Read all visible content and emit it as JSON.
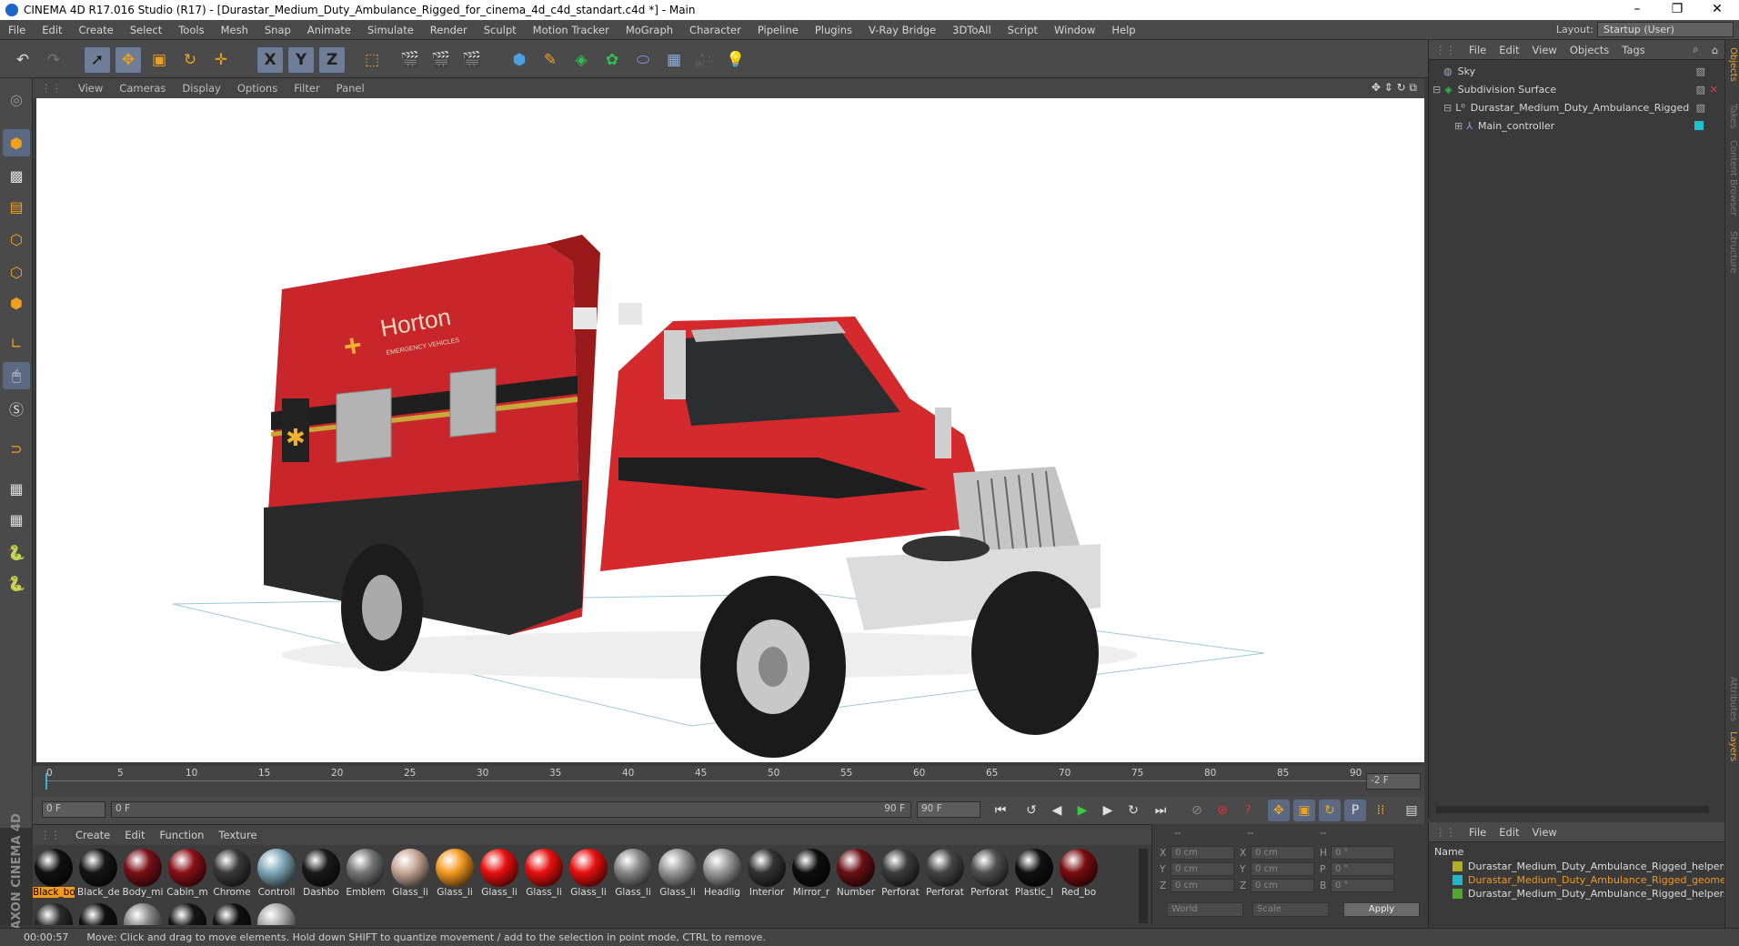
{
  "window": {
    "title": "CINEMA 4D R17.016 Studio (R17) - [Durastar_Medium_Duty_Ambulance_Rigged_for_cinema_4d_c4d_standart.c4d *] - Main",
    "minimize": "–",
    "restore": "❐",
    "close": "✕"
  },
  "menu": [
    "File",
    "Edit",
    "Create",
    "Select",
    "Tools",
    "Mesh",
    "Snap",
    "Animate",
    "Simulate",
    "Render",
    "Sculpt",
    "Motion Tracker",
    "MoGraph",
    "Character",
    "Pipeline",
    "Plugins",
    "V-Ray Bridge",
    "3DToAll",
    "Script",
    "Window",
    "Help"
  ],
  "layout": {
    "label": "Layout:",
    "value": "Startup (User)"
  },
  "toolbar": {
    "x": "X",
    "y": "Y",
    "z": "Z",
    "param": "P"
  },
  "viewport_menu": [
    "View",
    "Cameras",
    "Display",
    "Options",
    "Filter",
    "Panel"
  ],
  "timeline": {
    "ticks": [
      "0",
      "5",
      "10",
      "15",
      "20",
      "25",
      "30",
      "35",
      "40",
      "45",
      "50",
      "55",
      "60",
      "65",
      "70",
      "75",
      "80",
      "85",
      "90"
    ],
    "current_right": "-2 F"
  },
  "transport": {
    "start": "0 F",
    "slider_left": "0 F",
    "slider_right": "90 F",
    "end": "90 F"
  },
  "materials": {
    "menu": [
      "Create",
      "Edit",
      "Function",
      "Texture"
    ],
    "row1": [
      {
        "name": "Black_bo",
        "color": "#111111",
        "selected": true
      },
      {
        "name": "Black_de",
        "color": "#151515"
      },
      {
        "name": "Body_mi",
        "color": "#7a1018"
      },
      {
        "name": "Cabin_m",
        "color": "#8a1018"
      },
      {
        "name": "Chrome",
        "color": "#3a3a3a"
      },
      {
        "name": "Controll",
        "color": "#7fa8b8"
      },
      {
        "name": "Dashbo",
        "color": "#1a1a1a"
      },
      {
        "name": "Emblem",
        "color": "#777777"
      },
      {
        "name": "Glass_li",
        "color": "#c8a898"
      },
      {
        "name": "Glass_li",
        "color": "#f59a20"
      },
      {
        "name": "Glass_li",
        "color": "#e81010"
      },
      {
        "name": "Glass_li",
        "color": "#e81010"
      },
      {
        "name": "Glass_li",
        "color": "#e81010"
      },
      {
        "name": "Glass_li",
        "color": "#888888"
      },
      {
        "name": "Glass_li",
        "color": "#999999"
      },
      {
        "name": "Headlig",
        "color": "#9a9a9a"
      },
      {
        "name": "Interior",
        "color": "#333333"
      },
      {
        "name": "Mirror_r",
        "color": "#0e0e0e"
      },
      {
        "name": "Number",
        "color": "#6a1014"
      },
      {
        "name": "Perforat",
        "color": "#3c3c3c"
      },
      {
        "name": "Perforat",
        "color": "#454545"
      },
      {
        "name": "Perforat",
        "color": "#505050"
      },
      {
        "name": "Plastic_l",
        "color": "#101010"
      },
      {
        "name": "Red_bo",
        "color": "#7a0c10"
      }
    ],
    "row2": [
      {
        "color": "#2a2a2a"
      },
      {
        "color": "#111111"
      },
      {
        "color": "#888888"
      },
      {
        "color": "#151515"
      },
      {
        "color": "#111111"
      },
      {
        "color": "#aaaaaa"
      }
    ],
    "brand": "MAXON CINEMA 4D"
  },
  "coords": {
    "headers": [
      "--",
      "--",
      "--"
    ],
    "rows": [
      {
        "a": "X",
        "av": "0 cm",
        "b": "X",
        "bv": "0 cm",
        "c": "H",
        "cv": "0 °"
      },
      {
        "a": "Y",
        "av": "0 cm",
        "b": "Y",
        "bv": "0 cm",
        "c": "P",
        "cv": "0 °"
      },
      {
        "a": "Z",
        "av": "0 cm",
        "b": "Z",
        "bv": "0 cm",
        "c": "B",
        "cv": "0 °"
      }
    ],
    "world": "World",
    "scale": "Scale",
    "apply": "Apply"
  },
  "objects": {
    "menu": [
      "File",
      "Edit",
      "View",
      "Objects",
      "Tags"
    ],
    "items": [
      {
        "name": "Sky",
        "indent": 0
      },
      {
        "name": "Subdivision Surface",
        "indent": 0
      },
      {
        "name": "Durastar_Medium_Duty_Ambulance_Rigged",
        "indent": 1
      },
      {
        "name": "Main_controller",
        "indent": 2
      }
    ]
  },
  "layers": {
    "menu": [
      "File",
      "Edit",
      "View"
    ],
    "header": "Name",
    "items": [
      {
        "name": "Durastar_Medium_Duty_Ambulance_Rigged_helpers_fre",
        "color": "#b0b020",
        "active": false
      },
      {
        "name": "Durastar_Medium_Duty_Ambulance_Rigged_geometry",
        "color": "#20b8c8",
        "active": true
      },
      {
        "name": "Durastar_Medium_Duty_Ambulance_Rigged_helpers",
        "color": "#50a830",
        "active": false
      }
    ]
  },
  "right_tabs": [
    "Objects",
    "Takes",
    "Content Browser",
    "Structure",
    "Attributes",
    "Layers"
  ],
  "status": {
    "time": "00:00:57",
    "message": "Move: Click and drag to move elements. Hold down SHIFT to quantize movement / add to the selection in point mode, CTRL to remove."
  },
  "truck": {
    "brand": "Horton",
    "sub": "EMERGENCY VEHICLES"
  }
}
